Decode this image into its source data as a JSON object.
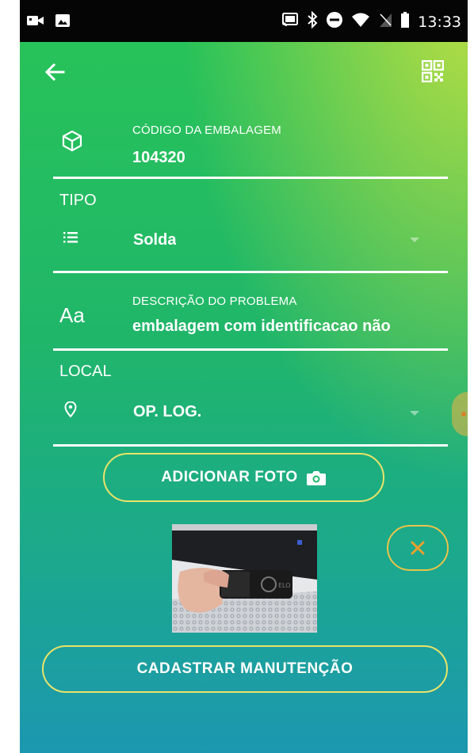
{
  "statusbar": {
    "time": "13:33",
    "left_icons": [
      "video-notification-icon",
      "image-notification-icon"
    ],
    "right_icons": [
      "cast-icon",
      "bluetooth-icon",
      "do-not-disturb-icon",
      "wifi-icon",
      "no-sim-icon",
      "battery-icon"
    ]
  },
  "appbar": {
    "back_icon": "arrow-left-icon",
    "scan_icon": "qr-code-icon"
  },
  "form": {
    "codigo_label": "CÓDIGO DA EMBALAGEM",
    "codigo_value": "104320",
    "codigo_icon": "cube-icon",
    "tipo_label": "TIPO",
    "tipo_value": "Solda",
    "tipo_icon": "list-icon",
    "descricao_label": "DESCRIÇÃO DO PROBLEMA",
    "descricao_value": "embalagem com identificacao não",
    "descricao_icon_text": "Aa",
    "local_label": "LOCAL",
    "local_value": "OP. LOG.",
    "local_icon": "location-pin-icon"
  },
  "actions": {
    "add_photo_label": "ADICIONAR FOTO",
    "add_photo_icon": "camera-icon",
    "remove_photo_icon": "close-icon",
    "submit_label": "CADASTRAR MANUTENÇÃO"
  },
  "colors": {
    "accent_border": "#e9e46a",
    "remove_accent": "#e8a030",
    "background_top": "#29c457",
    "background_bottom": "#1c97b0"
  }
}
